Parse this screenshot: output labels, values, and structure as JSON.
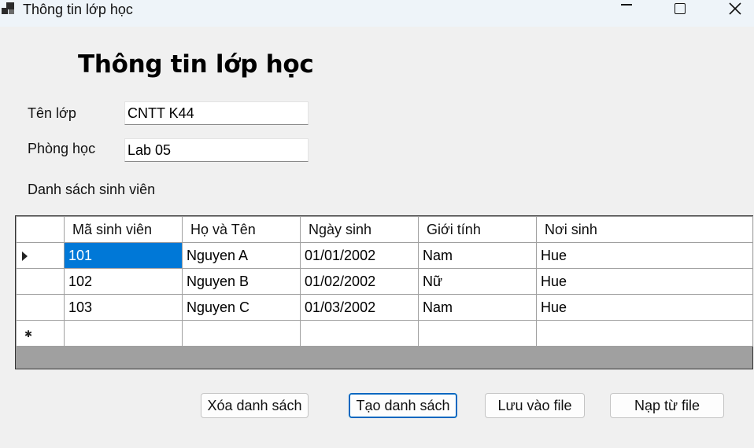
{
  "window": {
    "title": "Thông tin lớp học"
  },
  "form": {
    "heading": "Thông tin lớp học",
    "class_name_label": "Tên lớp",
    "class_name_value": "CNTT K44",
    "room_label": "Phòng học",
    "room_value": "Lab 05",
    "student_list_label": "Danh sách sinh viên"
  },
  "grid": {
    "columns": [
      "Mã sinh viên",
      "Họ và Tên",
      "Ngày sinh",
      "Giới tính",
      "Nơi sinh"
    ],
    "rows": [
      [
        "101",
        "Nguyen A",
        "01/01/2002",
        "Nam",
        "Hue"
      ],
      [
        "102",
        "Nguyen B",
        "01/02/2002",
        "Nữ",
        "Hue"
      ],
      [
        "103",
        "Nguyen C",
        "01/03/2002",
        "Nam",
        "Hue"
      ]
    ],
    "selected_cell": "101",
    "icons": {
      "current_row": "triangle-right-icon",
      "new_row": "asterisk-icon"
    }
  },
  "buttons": {
    "clear": "Xóa danh sách",
    "create": "Tạo danh sách",
    "save": "Lưu vào file",
    "load": "Nạp từ file"
  },
  "colors": {
    "selection": "#0078d7",
    "grid_background": "#a0a0a0",
    "focused_button_border": "#0067c0"
  }
}
